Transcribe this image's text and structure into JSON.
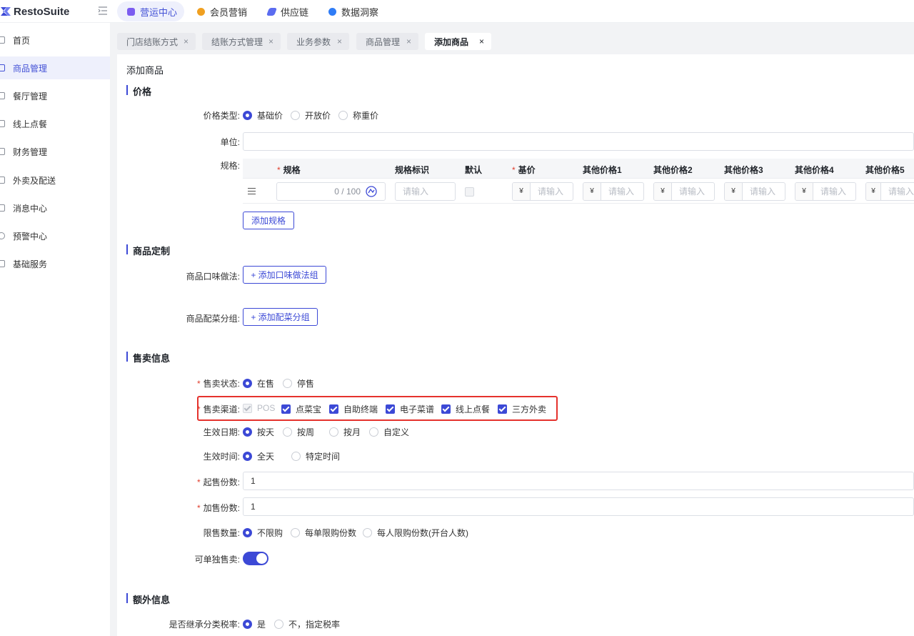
{
  "app": {
    "name": "RestoSuite"
  },
  "topnav": [
    {
      "label": "营运中心",
      "active": true,
      "color": "#7b5cf0"
    },
    {
      "label": "会员营销",
      "active": false,
      "color": "#f0a020"
    },
    {
      "label": "供应链",
      "active": false,
      "color": "#5b6cf0"
    },
    {
      "label": "数据洞察",
      "active": false,
      "color": "#2f7cf6"
    }
  ],
  "sidebar": {
    "items": [
      {
        "label": "首页",
        "icon": "home-icon"
      },
      {
        "label": "商品管理",
        "icon": "box-icon",
        "active": true
      },
      {
        "label": "餐厅管理",
        "icon": "store-icon"
      },
      {
        "label": "线上点餐",
        "icon": "hand-icon"
      },
      {
        "label": "财务管理",
        "icon": "wallet-icon"
      },
      {
        "label": "外卖及配送",
        "icon": "bag-icon"
      },
      {
        "label": "消息中心",
        "icon": "mail-icon"
      },
      {
        "label": "预警中心",
        "icon": "bulb-icon"
      },
      {
        "label": "基础服务",
        "icon": "grid-icon"
      }
    ]
  },
  "tabs": [
    {
      "label": "门店结账方式",
      "active": false
    },
    {
      "label": "结账方式管理",
      "active": false
    },
    {
      "label": "业务参数",
      "active": false
    },
    {
      "label": "商品管理",
      "active": false
    },
    {
      "label": "添加商品",
      "active": true
    }
  ],
  "close_glyph": "×",
  "page": {
    "title": "添加商品"
  },
  "price_section": {
    "title": "价格",
    "price_type_label": "价格类型:",
    "price_types": [
      "基础价",
      "开放价",
      "称重价"
    ],
    "price_type_selected": "基础价",
    "unit_label": "单位:",
    "unit_value": "",
    "spec_label": "规格:",
    "spec_table": {
      "headers": {
        "spec": "规格",
        "spec_tag": "规格标识",
        "default": "默认",
        "base_price": "基价",
        "other1": "其他价格1",
        "other2": "其他价格2",
        "other3": "其他价格3",
        "other4": "其他价格4",
        "other5": "其他价格5"
      },
      "spec_counter": "0 / 100",
      "placeholder": "请输入",
      "currency": "¥"
    },
    "add_spec_button": "添加规格"
  },
  "custom_section": {
    "title": "商品定制",
    "flavor_label": "商品口味做法:",
    "flavor_button": "+ 添加口味做法组",
    "side_label": "商品配菜分组:",
    "side_button": "+ 添加配菜分组"
  },
  "sale_section": {
    "title": "售卖信息",
    "status_label": "售卖状态:",
    "status_options": [
      "在售",
      "停售"
    ],
    "status_selected": "在售",
    "channel_label": "售卖渠道:",
    "channels": [
      {
        "label": "POS",
        "checked": true,
        "disabled": true
      },
      {
        "label": "点菜宝",
        "checked": true
      },
      {
        "label": "自助终端",
        "checked": true
      },
      {
        "label": "电子菜谱",
        "checked": true
      },
      {
        "label": "线上点餐",
        "checked": true
      },
      {
        "label": "三方外卖",
        "checked": true
      }
    ],
    "date_label": "生效日期:",
    "date_options": [
      "按天",
      "按周",
      "按月",
      "自定义"
    ],
    "date_selected": "按天",
    "time_label": "生效时间:",
    "time_options": [
      "全天",
      "特定时间"
    ],
    "time_selected": "全天",
    "min_qty_label": "起售份数:",
    "min_qty_value": "1",
    "add_qty_label": "加售份数:",
    "add_qty_value": "1",
    "limit_label": "限售数量:",
    "limit_options": [
      "不限购",
      "每单限购份数",
      "每人限购份数(开台人数)"
    ],
    "limit_selected": "不限购",
    "single_sale_label": "可单独售卖:",
    "single_sale_on": true
  },
  "extra_section": {
    "title": "额外信息",
    "tax_label": "是否继承分类税率:",
    "tax_options": [
      "是",
      "不，指定税率"
    ],
    "tax_selected": "是"
  },
  "colors": {
    "accent": "#3c49d6",
    "required": "#e03e2d",
    "highlight": "#e5322d"
  }
}
